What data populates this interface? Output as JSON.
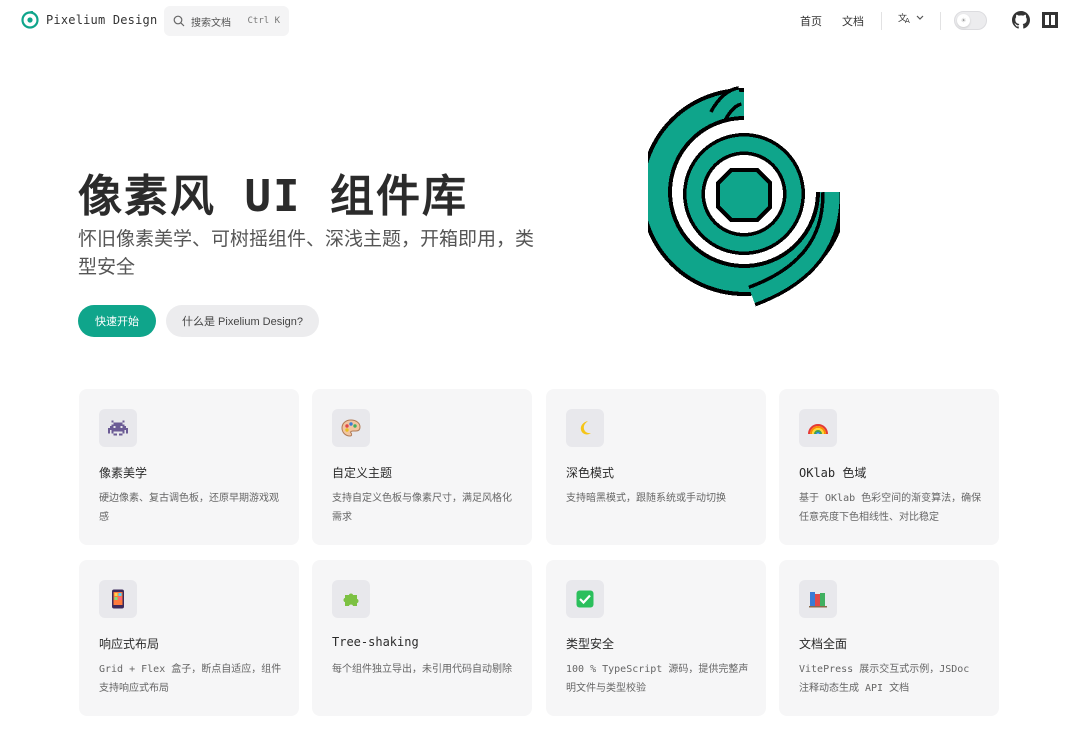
{
  "brand": {
    "name": "Pixelium Design"
  },
  "search": {
    "placeholder": "搜索文档",
    "shortcut": "Ctrl K"
  },
  "nav": {
    "home": "首页",
    "docs": "文档",
    "lang_icon": "translate-icon"
  },
  "hero": {
    "title": "像素风 UI 组件库",
    "subtitle": "怀旧像素美学、可树摇组件、深浅主题，开箱即用，类型安全",
    "primary_button": "快速开始",
    "secondary_button": "什么是 Pixelium Design?"
  },
  "colors": {
    "accent": "#0fa58b",
    "logo_green": "#0fa58b",
    "card_bg": "#f6f6f7"
  },
  "features": [
    {
      "icon": "space-invader-icon",
      "title": "像素美学",
      "desc": "硬边像素、复古调色板，还原早期游戏观感"
    },
    {
      "icon": "palette-icon",
      "title": "自定义主题",
      "desc": "支持自定义色板与像素尺寸，满足风格化需求"
    },
    {
      "icon": "moon-icon",
      "title": "深色模式",
      "desc": "支持暗黑模式，跟随系统或手动切换"
    },
    {
      "icon": "rainbow-icon",
      "title": "OKlab 色域",
      "desc": "基于 OKlab 色彩空间的渐变算法，确保任意亮度下色相线性、对比稳定"
    },
    {
      "icon": "phone-icon",
      "title": "响应式布局",
      "desc": "Grid + Flex 盒子，断点自适应，组件支持响应式布局"
    },
    {
      "icon": "puzzle-icon",
      "title": "Tree-shaking",
      "desc": "每个组件独立导出，未引用代码自动剔除"
    },
    {
      "icon": "check-icon",
      "title": "类型安全",
      "desc": "100 % TypeScript 源码，提供完整声明文件与类型校验"
    },
    {
      "icon": "books-icon",
      "title": "文档全面",
      "desc": "VitePress 展示交互式示例，JSDoc 注释动态生成 API 文档"
    }
  ]
}
